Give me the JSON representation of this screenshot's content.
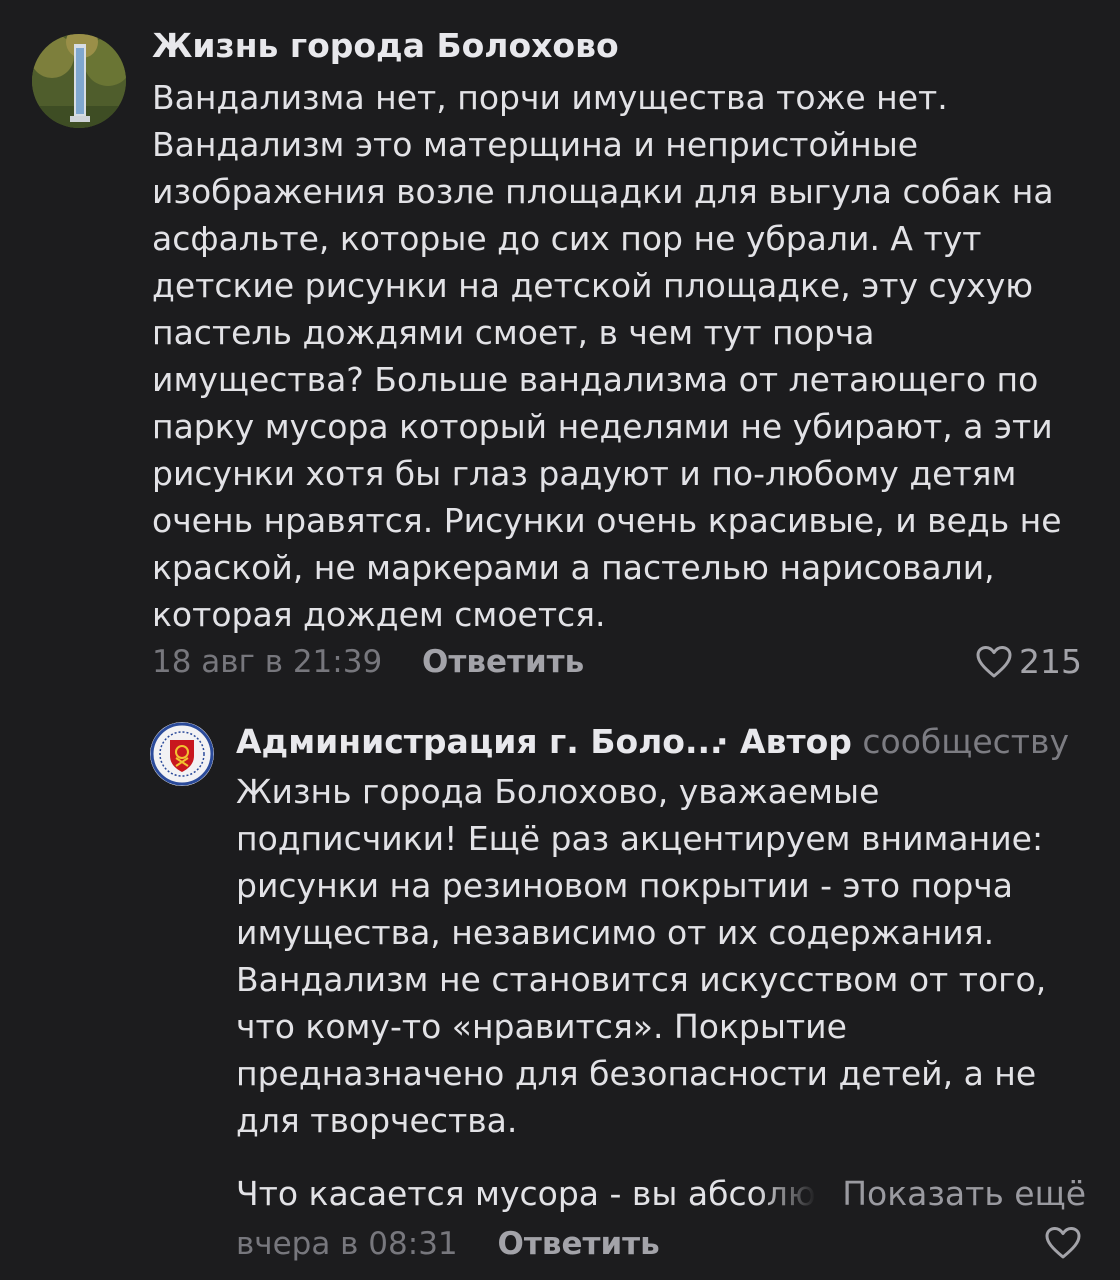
{
  "comments": [
    {
      "author": "Жизнь города Болохово",
      "avatar_icon": "stele-avatar-icon",
      "text": "Вандализма нет, порчи имущества тоже нет.\nВандализм это матерщина и непристойные\nизображения возле площадки для выгула собак на\nасфальте, которые до сих пор не убрали. А тут\nдетские рисунки на детской площадке, эту сухую\nпастель дождями смоет, в чем тут порча\nимущества? Больше вандализма от летающего по\nпарку мусора который неделями не убирают, а эти\nрисунки хотя бы глаз радуют и по-любому детям\nочень нравятся. Рисунки очень красивые, и ведь не\nкраской, не маркерами а пастелью нарисовали,\nкоторая дождем смоется.",
      "time": "18 авг в 21:39",
      "reply_label": "Ответить",
      "likes": "215",
      "heart_icon": "heart-outline-icon"
    },
    {
      "author": "Администрация г. Боло...",
      "author_badge": "· Автор",
      "author_suffix": "сообществу",
      "avatar_icon": "coat-of-arms-icon",
      "text": "Жизнь города Болохово, уважаемые\nподписчики! Ещё раз акцентируем внимание:\nрисунки на резиновом покрытии - это порча\nимущества, независимо от их содержания.\nВандализм не становится искусством от того,\nчто кому-то «нравится». Покрытие\nпредназначено для безопасности детей, а не\nдля творчества.",
      "truncated_text": "Что касается мусора - вы абсолю",
      "show_more_label": "Показать ещё",
      "time": "вчера в 08:31",
      "reply_label": "Ответить",
      "heart_icon": "heart-outline-icon"
    }
  ],
  "colors": {
    "background": "#1c1c1e",
    "text": "#e2e2e6",
    "muted": "#77777d",
    "accent_red": "#c8171e"
  }
}
